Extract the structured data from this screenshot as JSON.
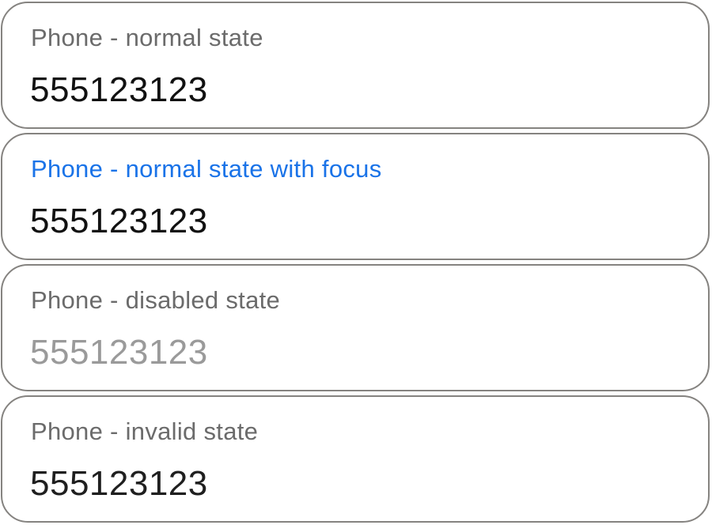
{
  "fields": [
    {
      "label": "Phone - normal state",
      "value": "555123123",
      "state": "normal"
    },
    {
      "label": "Phone - normal state with focus",
      "value": "555123123",
      "state": "focused"
    },
    {
      "label": "Phone - disabled state",
      "value": "555123123",
      "state": "disabled"
    },
    {
      "label": "Phone - invalid state",
      "value": "555123123",
      "state": "invalid"
    }
  ],
  "colors": {
    "border": "#858380",
    "label": "#6b6b6b",
    "focus_label": "#1a73e8",
    "value": "#111111",
    "disabled_value": "#9a9a9a"
  }
}
